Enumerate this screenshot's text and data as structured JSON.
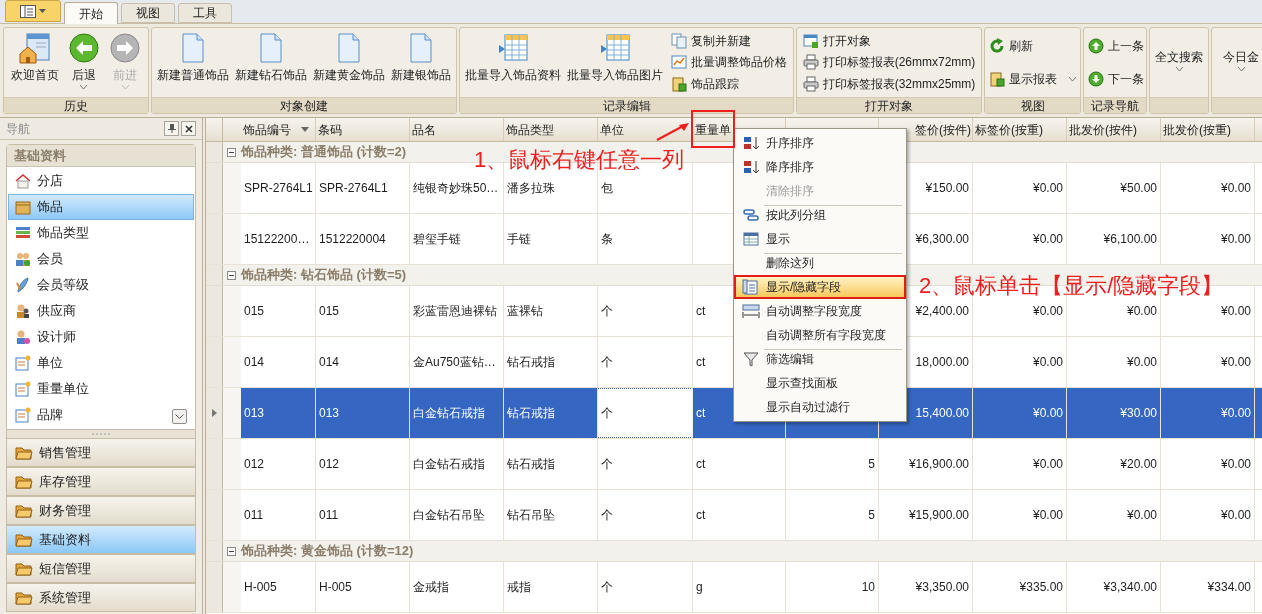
{
  "tabs": [
    {
      "label": "开始",
      "selected": true
    },
    {
      "label": "视图",
      "selected": false
    },
    {
      "label": "工具",
      "selected": false
    }
  ],
  "ribbon_groups": [
    {
      "label": "历史",
      "items": [
        {
          "kind": "large",
          "label": "欢迎首页",
          "disabled": false,
          "dropdown": false
        },
        {
          "kind": "large",
          "label": "后退",
          "disabled": false,
          "dropdown": true
        },
        {
          "kind": "large",
          "label": "前进",
          "disabled": true,
          "dropdown": true
        }
      ]
    },
    {
      "label": "对象创建",
      "items": [
        {
          "kind": "large",
          "label": "新建普通饰品",
          "disabled": false,
          "dropdown": false
        },
        {
          "kind": "large",
          "label": "新建钻石饰品",
          "disabled": false,
          "dropdown": false
        },
        {
          "kind": "large",
          "label": "新建黄金饰品",
          "disabled": false,
          "dropdown": false
        },
        {
          "kind": "large",
          "label": "新建银饰品",
          "disabled": false,
          "dropdown": false
        }
      ]
    },
    {
      "label": "记录编辑",
      "items": [
        {
          "kind": "large",
          "label": "批量导入饰品资料",
          "disabled": false,
          "dropdown": false
        },
        {
          "kind": "large",
          "label": "批量导入饰品图片",
          "disabled": false,
          "dropdown": false
        },
        {
          "kind": "small",
          "label": "复制并新建",
          "disabled": false,
          "dropdown": false
        },
        {
          "kind": "small",
          "label": "批量调整饰品价格",
          "disabled": false,
          "dropdown": false
        },
        {
          "kind": "small",
          "label": "饰品跟踪",
          "disabled": false,
          "dropdown": false
        }
      ]
    },
    {
      "label": "打开对象",
      "items": [
        {
          "kind": "small",
          "label": "打开对象",
          "disabled": false,
          "dropdown": false
        },
        {
          "kind": "small",
          "label": "打印标签报表(26mmx72mm)",
          "disabled": false,
          "dropdown": false
        },
        {
          "kind": "small",
          "label": "打印标签报表(32mmx25mm)",
          "disabled": false,
          "dropdown": false
        }
      ]
    },
    {
      "label": "视图",
      "items": [
        {
          "kind": "small",
          "label": "刷新",
          "disabled": false,
          "dropdown": false
        },
        {
          "kind": "small",
          "label": "显示报表",
          "disabled": false,
          "dropdown": true
        }
      ]
    },
    {
      "label": "记录导航",
      "items": [
        {
          "kind": "small",
          "label": "上一条",
          "disabled": false,
          "dropdown": false
        },
        {
          "kind": "small",
          "label": "下一条",
          "disabled": false,
          "dropdown": false
        }
      ]
    },
    {
      "items": [
        {
          "kind": "text",
          "label": "全文搜索",
          "disabled": false,
          "dropdown": true
        }
      ]
    },
    {
      "items": [
        {
          "kind": "text",
          "label": "今日金",
          "disabled": false,
          "dropdown": true
        }
      ]
    }
  ],
  "navigation": {
    "title": "导航",
    "section": "基础资料",
    "items": [
      {
        "label": "分店",
        "selected": false
      },
      {
        "label": "饰品",
        "selected": true
      },
      {
        "label": "饰品类型",
        "selected": false
      },
      {
        "label": "会员",
        "selected": false
      },
      {
        "label": "会员等级",
        "selected": false
      },
      {
        "label": "供应商",
        "selected": false
      },
      {
        "label": "设计师",
        "selected": false
      },
      {
        "label": "单位",
        "selected": false
      },
      {
        "label": "重量单位",
        "selected": false
      },
      {
        "label": "品牌",
        "selected": false
      }
    ],
    "groups": [
      {
        "label": "销售管理",
        "selected": false
      },
      {
        "label": "库存管理",
        "selected": false
      },
      {
        "label": "财务管理",
        "selected": false
      },
      {
        "label": "基础资料",
        "selected": true
      },
      {
        "label": "短信管理",
        "selected": false
      },
      {
        "label": "系统管理",
        "selected": false
      }
    ]
  },
  "grid": {
    "columns": [
      "饰品编号",
      "条码",
      "品名",
      "饰品类型",
      "单位",
      "重量单",
      null,
      "签价(按件)",
      "标签价(按重)",
      "批发价(按件)",
      "批发价(按重)"
    ],
    "groups": [
      {
        "label": "饰品种类: 普通饰品 (计数=2)",
        "rows": [
          {
            "selected": false,
            "cells": [
              "SPR-2764L1",
              "SPR-2764L1",
              "纯银奇妙珠50…",
              "潘多拉珠",
              "包",
              null,
              null,
              "¥150.00",
              "¥0.00",
              "¥50.00",
              "¥0.00"
            ]
          },
          {
            "selected": false,
            "cells": [
              "15122200…",
              "1512220004",
              "碧玺手链",
              "手链",
              "条",
              null,
              null,
              "¥6,300.00",
              "¥0.00",
              "¥6,100.00",
              "¥0.00"
            ]
          }
        ]
      },
      {
        "label": "饰品种类: 钻石饰品 (计数=5)",
        "rows": [
          {
            "selected": false,
            "cells": [
              "015",
              "015",
              "彩蓝雷恩迪裸钻",
              "蓝裸钻",
              "个",
              "ct",
              null,
              "¥2,400.00",
              "¥0.00",
              "¥0.00",
              "¥0.00"
            ]
          },
          {
            "selected": false,
            "cells": [
              "014",
              "014",
              "金Au750蓝钻…",
              "钻石戒指",
              "个",
              "ct",
              null,
              "18,000.00",
              "¥0.00",
              "¥0.00",
              "¥0.00"
            ]
          },
          {
            "selected": true,
            "cells": [
              "013",
              "013",
              "白金钻石戒指",
              "钻石戒指",
              "个",
              "ct",
              null,
              "15,400.00",
              "¥0.00",
              "¥30.00",
              "¥0.00"
            ]
          },
          {
            "selected": false,
            "cells": [
              "012",
              "012",
              "白金钻石戒指",
              "钻石戒指",
              "个",
              "ct",
              "5",
              "¥16,900.00",
              "¥0.00",
              "¥20.00",
              "¥0.00"
            ]
          },
          {
            "selected": false,
            "cells": [
              "011",
              "011",
              "白金钻石吊坠",
              "钻石吊坠",
              "个",
              "ct",
              "5",
              "¥15,900.00",
              "¥0.00",
              "¥0.00",
              "¥0.00"
            ]
          }
        ]
      },
      {
        "label": "饰品种类: 黄金饰品 (计数=12)",
        "rows": [
          {
            "selected": false,
            "cells": [
              "H-005",
              "H-005",
              "金戒指",
              "戒指",
              "个",
              "g",
              "10",
              "¥3,350.00",
              "¥335.00",
              "¥3,340.00",
              "¥334.00"
            ]
          }
        ]
      }
    ]
  },
  "context_menu": [
    {
      "label": "升序排序",
      "disabled": false,
      "selected": false,
      "separator": false
    },
    {
      "label": "降序排序",
      "disabled": false,
      "selected": false,
      "separator": false
    },
    {
      "label": "清除排序",
      "disabled": true,
      "selected": false,
      "separator": false
    },
    {
      "label": "按此列分组",
      "disabled": false,
      "selected": false,
      "separator": true
    },
    {
      "label": "显示",
      "disabled": false,
      "selected": false,
      "separator": false
    },
    {
      "label": "删除这列",
      "disabled": false,
      "selected": false,
      "separator": true
    },
    {
      "label": "显示/隐藏字段",
      "disabled": false,
      "selected": true,
      "separator": false
    },
    {
      "label": "自动调整字段宽度",
      "disabled": false,
      "selected": false,
      "separator": false
    },
    {
      "label": "自动调整所有字段宽度",
      "disabled": false,
      "selected": false,
      "separator": false
    },
    {
      "label": "筛选编辑",
      "disabled": false,
      "selected": false,
      "separator": true
    },
    {
      "label": "显示查找面板",
      "disabled": false,
      "selected": false,
      "separator": false
    },
    {
      "label": "显示自动过滤行",
      "disabled": false,
      "selected": false,
      "separator": false
    }
  ],
  "annotations": [
    {
      "label": "1、鼠标右键任意一列"
    },
    {
      "label": "2、鼠标单击【显示/隐藏字段】"
    }
  ]
}
